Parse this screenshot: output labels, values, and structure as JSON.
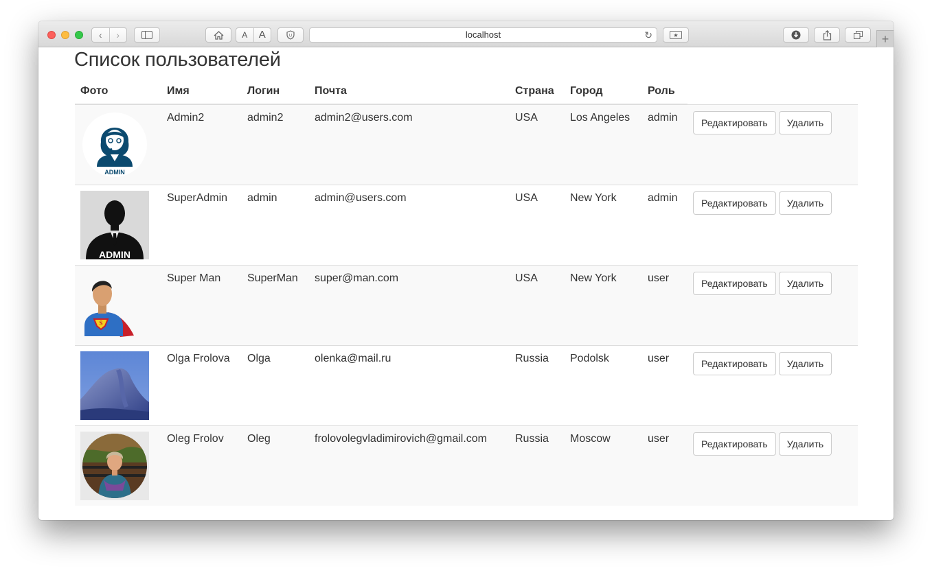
{
  "browser": {
    "address": "localhost"
  },
  "page": {
    "title": "Список пользователей"
  },
  "table": {
    "headers": {
      "photo": "Фото",
      "name": "Имя",
      "login": "Логин",
      "email": "Почта",
      "country": "Страна",
      "city": "Город",
      "role": "Роль"
    },
    "actions": {
      "edit": "Редактировать",
      "delete": "Удалить"
    },
    "rows": [
      {
        "photo": "admin-headset-avatar",
        "name": "Admin2",
        "login": "admin2",
        "email": "admin2@users.com",
        "country": "USA",
        "city": "Los Angeles",
        "role": "admin",
        "photo_label": "ADMIN"
      },
      {
        "photo": "admin-silhouette-avatar",
        "name": "SuperAdmin",
        "login": "admin",
        "email": "admin@users.com",
        "country": "USA",
        "city": "New York",
        "role": "admin",
        "photo_label": "ADMIN"
      },
      {
        "photo": "superman-avatar",
        "name": "Super Man",
        "login": "SuperMan",
        "email": "super@man.com",
        "country": "USA",
        "city": "New York",
        "role": "user"
      },
      {
        "photo": "mountain-photo",
        "name": "Olga Frolova",
        "login": "Olga",
        "email": "olenka@mail.ru",
        "country": "Russia",
        "city": "Podolsk",
        "role": "user"
      },
      {
        "photo": "person-round-photo",
        "name": "Oleg Frolov",
        "login": "Oleg",
        "email": "frolovolegvladimirovich@gmail.com",
        "country": "Russia",
        "city": "Moscow",
        "role": "user"
      }
    ]
  }
}
